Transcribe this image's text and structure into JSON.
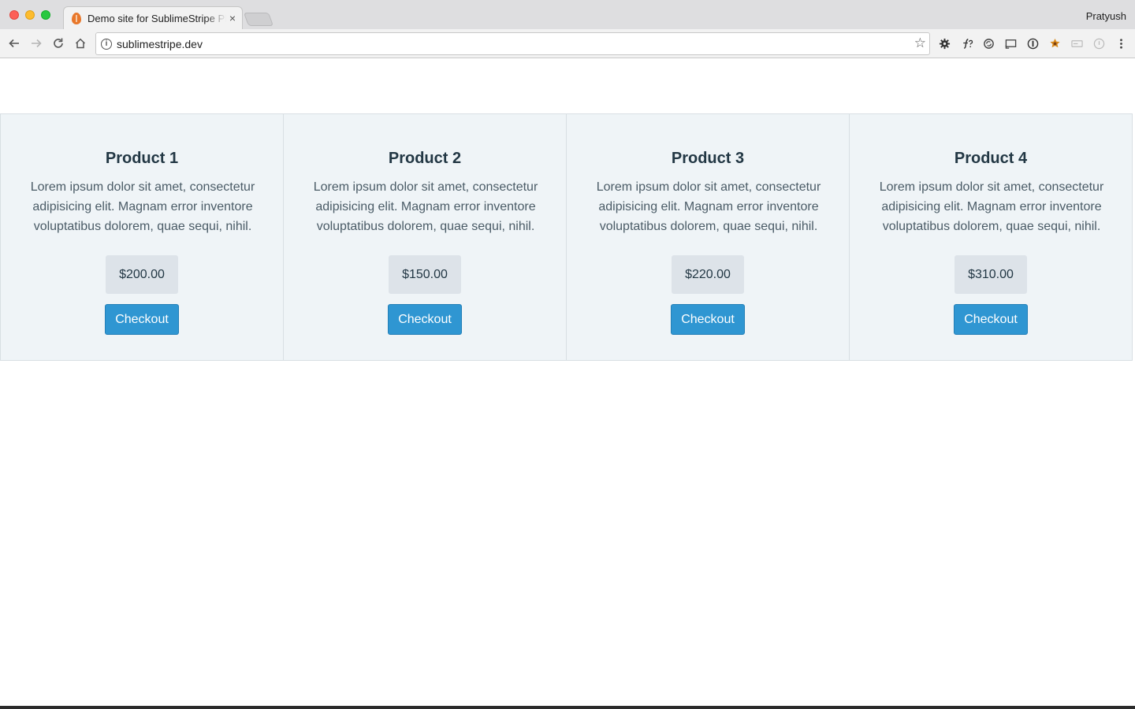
{
  "browser": {
    "tab_title": "Demo site for SublimeStripe Plugin",
    "tab_close": "×",
    "profile_name": "Pratyush",
    "url": "sublimestripe.dev",
    "info_glyph": "i",
    "star_glyph": "☆"
  },
  "products": [
    {
      "title": "Product 1",
      "description": "Lorem ipsum dolor sit amet, consectetur adipisicing elit. Magnam error inventore voluptatibus dolorem, quae sequi, nihil.",
      "price": "$200.00",
      "button": "Checkout"
    },
    {
      "title": "Product 2",
      "description": "Lorem ipsum dolor sit amet, consectetur adipisicing elit. Magnam error inventore voluptatibus dolorem, quae sequi, nihil.",
      "price": "$150.00",
      "button": "Checkout"
    },
    {
      "title": "Product 3",
      "description": "Lorem ipsum dolor sit amet, consectetur adipisicing elit. Magnam error inventore voluptatibus dolorem, quae sequi, nihil.",
      "price": "$220.00",
      "button": "Checkout"
    },
    {
      "title": "Product 4",
      "description": "Lorem ipsum dolor sit amet, consectetur adipisicing elit. Magnam error inventore voluptatibus dolorem, quae sequi, nihil.",
      "price": "$310.00",
      "button": "Checkout"
    }
  ],
  "colors": {
    "checkout_button": "#2f96d2",
    "card_background": "#eff4f7",
    "price_background": "#dde3e9"
  },
  "icons": {
    "back": "back-arrow-icon",
    "forward": "forward-arrow-icon",
    "reload": "reload-icon",
    "home": "home-icon",
    "bookmark": "star-icon",
    "extensions": [
      "gear-icon",
      "function-icon",
      "sync-icon",
      "cast-icon",
      "password-icon",
      "badge-icon",
      "card-icon",
      "circle-icon",
      "more-menu-icon"
    ]
  }
}
